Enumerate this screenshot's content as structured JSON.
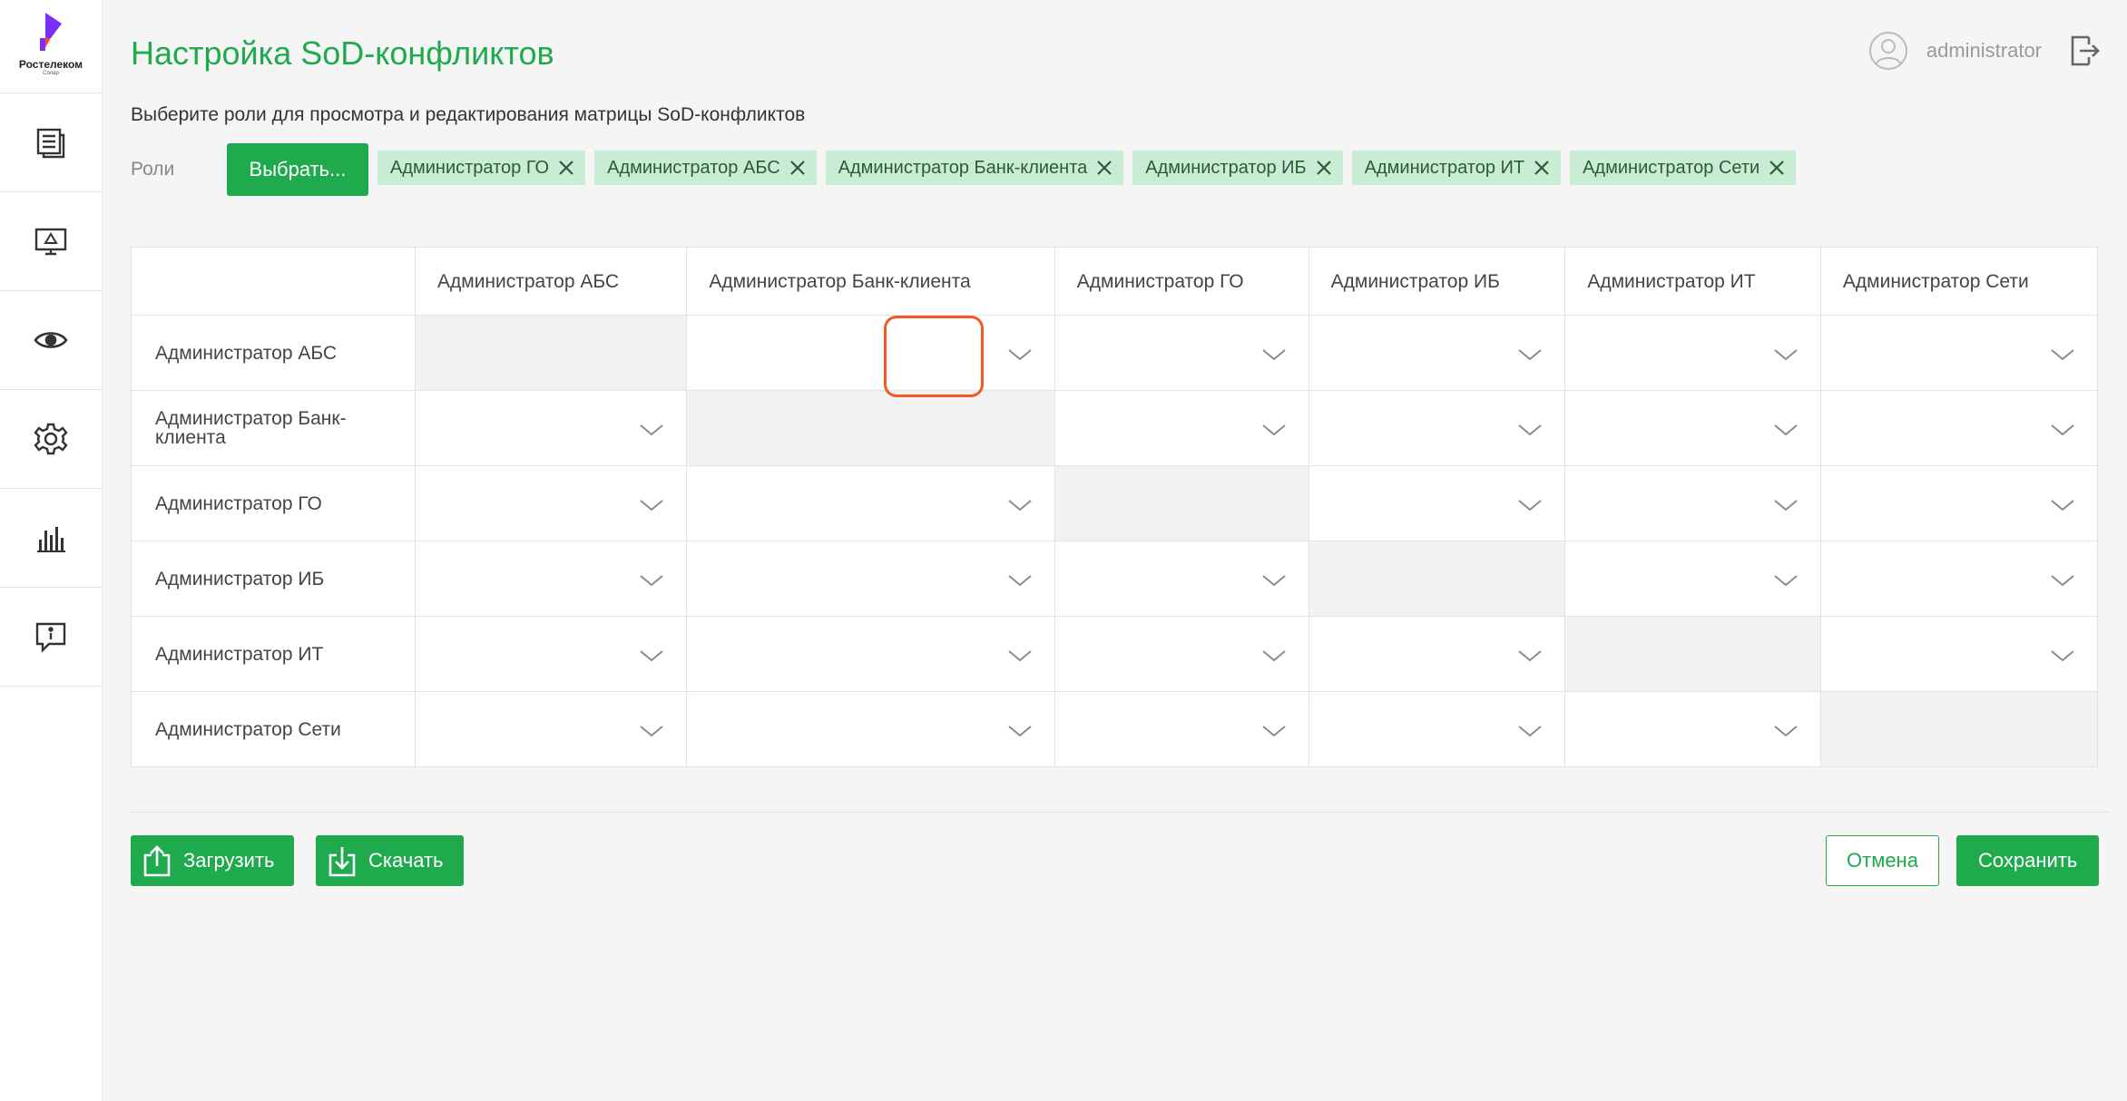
{
  "app": {
    "logo_text": "Ростелеком",
    "logo_sub": "Солар"
  },
  "sidebar": {
    "items": [
      {
        "name": "documents"
      },
      {
        "name": "monitor"
      },
      {
        "name": "view"
      },
      {
        "name": "settings"
      },
      {
        "name": "reports"
      },
      {
        "name": "feedback"
      }
    ]
  },
  "header": {
    "title": "Настройка SoD-конфликтов",
    "username": "administrator"
  },
  "roles": {
    "instruction": "Выберите роли для просмотра и редактирования матрицы SoD-конфликтов",
    "label": "Роли",
    "select_button": "Выбрать...",
    "tags": [
      "Администратор ГО",
      "Администратор АБС",
      "Администратор Банк-клиента",
      "Администратор ИБ",
      "Администратор ИТ",
      "Администратор Сети"
    ]
  },
  "matrix": {
    "columns": [
      "Администратор АБС",
      "Администратор Банк-клиента",
      "Администратор ГО",
      "Администратор ИБ",
      "Администратор ИТ",
      "Администратор Сети"
    ],
    "rows": [
      "Администратор АБС",
      "Администратор Банк-клиента",
      "Администратор ГО",
      "Администратор ИБ",
      "Администратор ИТ",
      "Администратор Сети"
    ],
    "highlighted_cell": {
      "row": 0,
      "col": 1
    }
  },
  "footer": {
    "upload_label": "Загрузить",
    "download_label": "Скачать",
    "cancel_label": "Отмена",
    "save_label": "Сохранить"
  },
  "colors": {
    "accent": "#1faa4d",
    "tag_bg": "#c8ecd4",
    "highlight": "#f15a24"
  }
}
